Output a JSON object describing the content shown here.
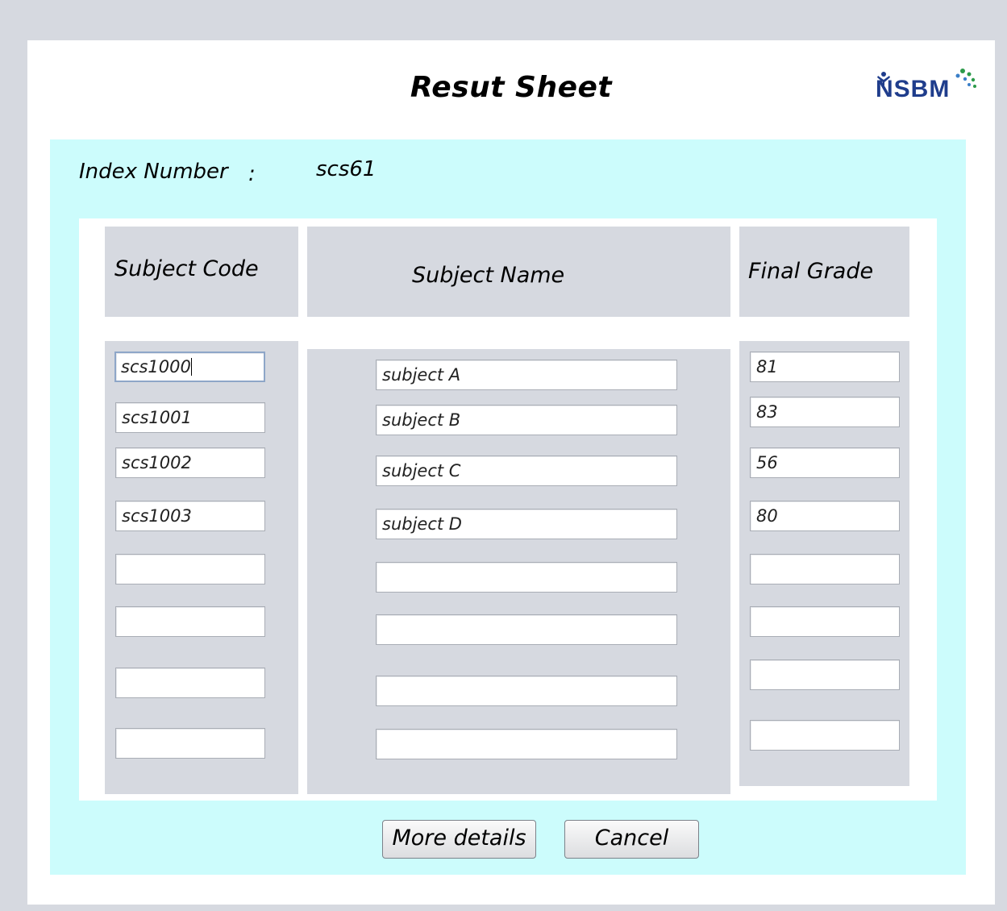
{
  "window": {
    "title": "Resut Sheet",
    "logo_text": "NSBM"
  },
  "index": {
    "label": "Index Number",
    "colon": ":",
    "value": "scs61"
  },
  "table": {
    "headers": {
      "code": "Subject Code",
      "name": "Subject Name",
      "grade": "Final Grade"
    },
    "codes": [
      "scs1000",
      "scs1001",
      "scs1002",
      "scs1003",
      "",
      "",
      "",
      ""
    ],
    "names": [
      "subject A",
      "subject B",
      "subject C",
      "subject D",
      "",
      "",
      "",
      ""
    ],
    "grades": [
      "81",
      "83",
      "56",
      "80",
      "",
      "",
      "",
      ""
    ]
  },
  "buttons": {
    "more_details": "More details",
    "cancel": "Cancel"
  },
  "colors": {
    "panel": "#ccfcfc",
    "column": "#d6d9e0",
    "logo": "#1f3d8c"
  }
}
